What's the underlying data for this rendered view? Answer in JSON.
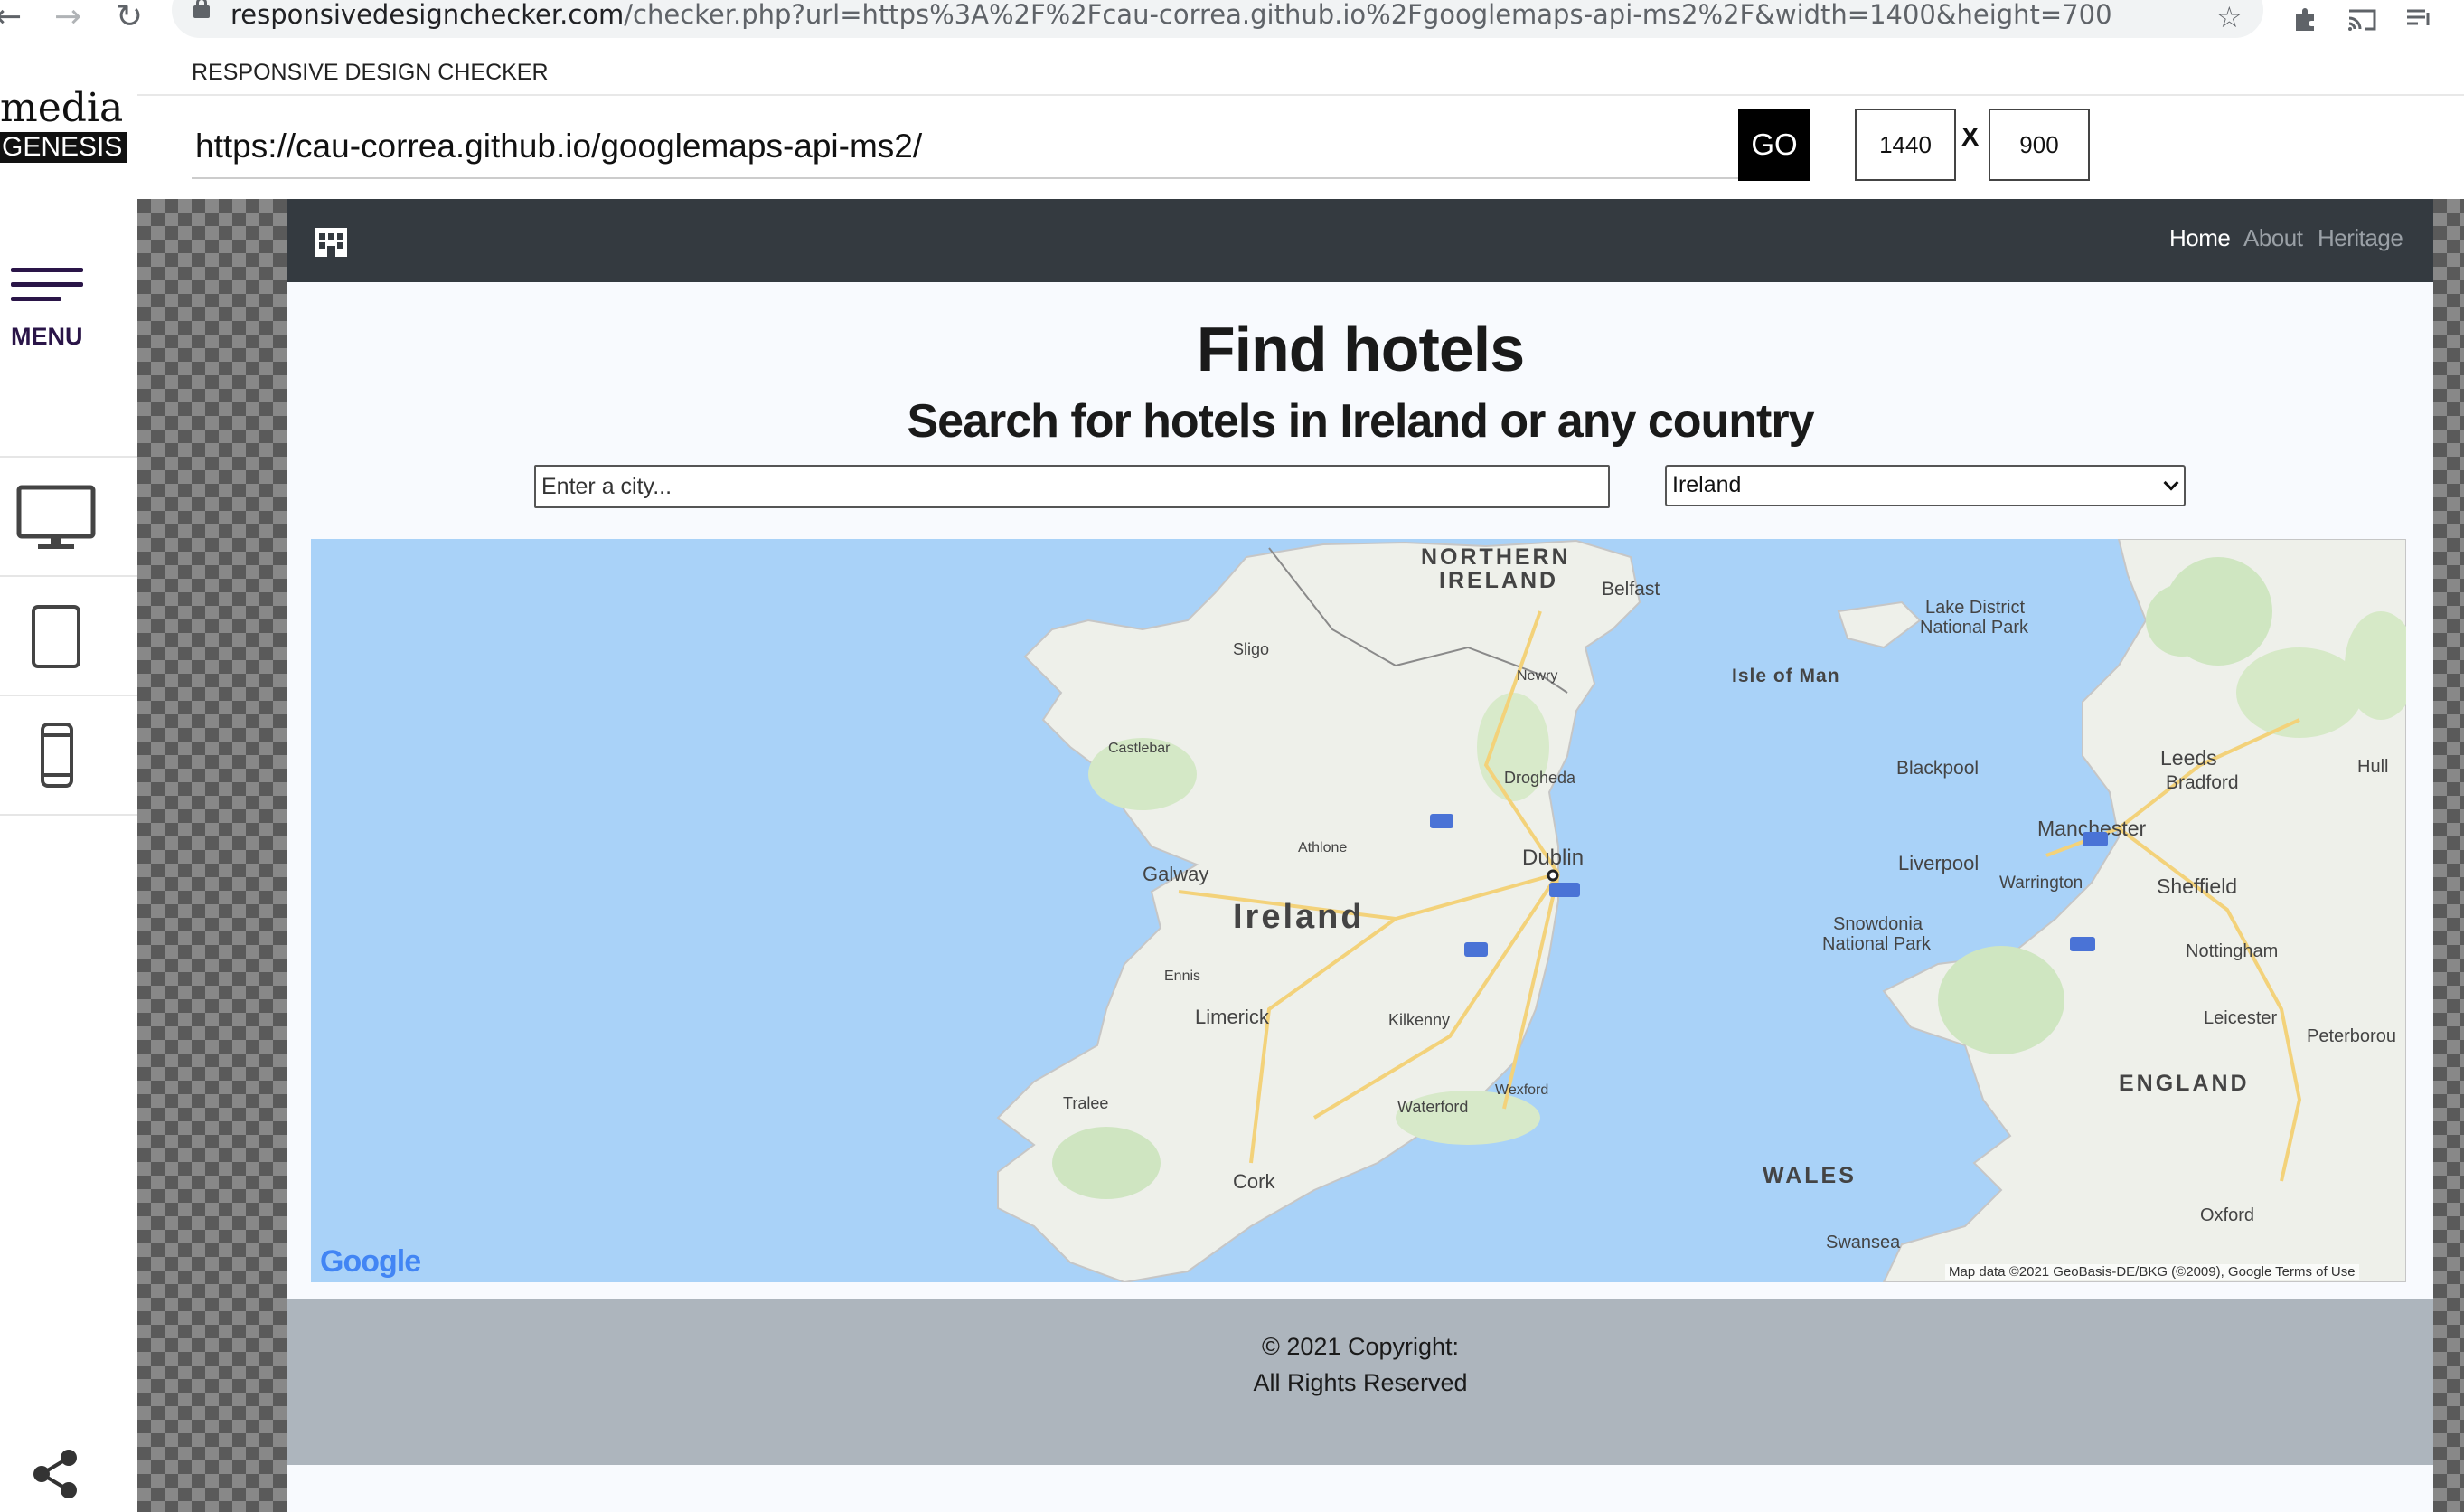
{
  "browser": {
    "url_host": "responsivedesignchecker.com",
    "url_rest": "/checker.php?url=https%3A%2F%2Fcau-correa.github.io%2Fgooglemaps-api-ms2%2F&width=1400&height=700"
  },
  "sidebar": {
    "brand_top": "media",
    "brand_bottom": "GENESIS",
    "menu_label": "MENU",
    "devices": [
      "desktop-icon",
      "tablet-icon",
      "phone-icon"
    ]
  },
  "checker": {
    "title": "RESPONSIVE DESIGN CHECKER",
    "url_value": "https://cau-correa.github.io/googlemaps-api-ms2/",
    "go_label": "GO",
    "width_value": "1440",
    "height_value": "900",
    "times_label": "X"
  },
  "site": {
    "nav": {
      "home": "Home",
      "about": "About",
      "heritage": "Heritage"
    },
    "title": "Find hotels",
    "subtitle": "Search for hotels in Ireland or any country",
    "city_placeholder": "Enter a city...",
    "country_selected": "Ireland",
    "map": {
      "labels": {
        "northern_ireland": "NORTHERN",
        "northern_ireland_2": "IRELAND",
        "ireland": "Ireland",
        "isle_of_man": "Isle of Man",
        "wales": "WALES",
        "england": "ENGLAND",
        "dublin": "Dublin",
        "belfast": "Belfast",
        "galway": "Galway",
        "limerick": "Limerick",
        "cork": "Cork",
        "sligo": "Sligo",
        "waterford": "Waterford",
        "kilkenny": "Kilkenny",
        "drogheda": "Drogheda",
        "liverpool": "Liverpool",
        "manchester": "Manchester",
        "leeds": "Leeds",
        "sheffield": "Sheffield",
        "blackpool": "Blackpool",
        "nottingham": "Nottingham",
        "leicester": "Leicester",
        "oxford": "Oxford",
        "swansea": "Swansea",
        "snowdonia": "Snowdonia",
        "snowdonia_2": "National Park",
        "lake_district": "Lake District",
        "lake_district_2": "National Park",
        "tralee": "Tralee",
        "ennis": "Ennis",
        "castlebar": "Castlebar",
        "athlone": "Athlone",
        "wexford": "Wexford",
        "newry": "Newry",
        "bradford": "Bradford",
        "warrington": "Warrington",
        "peterborough": "Peterborou",
        "hull": "Hull"
      },
      "logo": "Google",
      "attribution": "Map data ©2021 GeoBasis-DE/BKG (©2009), Google   Terms of Use"
    },
    "footer_line1": "© 2021 Copyright:",
    "footer_line2": "All Rights Reserved"
  }
}
